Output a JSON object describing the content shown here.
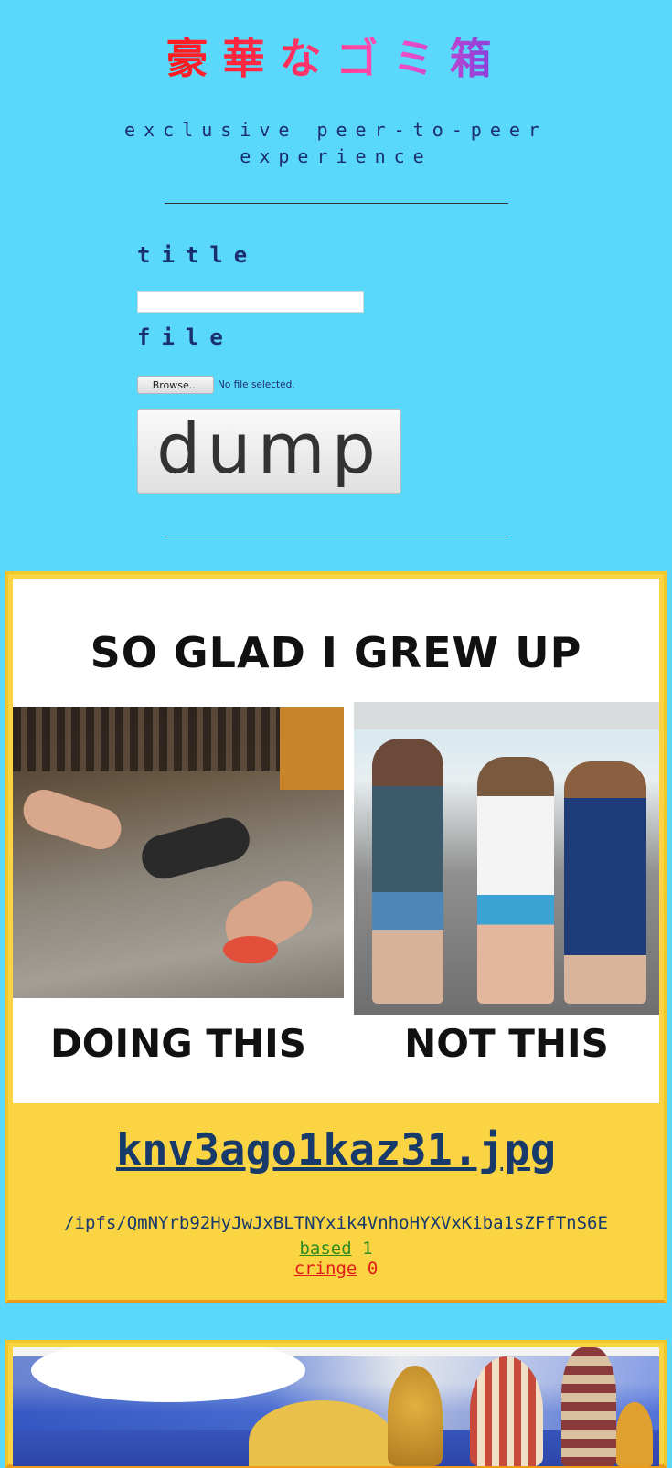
{
  "header": {
    "site_title": "豪華なゴミ箱",
    "tagline": "exclusive peer-to-peer experience"
  },
  "upload_form": {
    "title_label": "title",
    "title_value": "",
    "file_label": "file",
    "browse_label": "Browse...",
    "file_status": "No file selected.",
    "submit_label": "dump"
  },
  "posts": [
    {
      "meme_top_text": "SO GLAD I GREW UP",
      "meme_left_caption": "DOING THIS",
      "meme_right_caption": "NOT THIS",
      "filename": "knv3ago1kaz31.jpg",
      "cid_path": "/ipfs/QmNYrb92HyJwJxBLTNYxik4VnhoHYXVxKiba1sZFfTnS6E",
      "based_label": "based",
      "based_count": "1",
      "cringe_label": "cringe",
      "cringe_count": "0"
    }
  ],
  "colors": {
    "background": "#5ad8fb",
    "card": "#fbd444",
    "card_border_bottom": "#f09a1a",
    "text_navy": "#173a6b",
    "based_green": "#2e8b1e",
    "cringe_red": "#e31b1b"
  }
}
